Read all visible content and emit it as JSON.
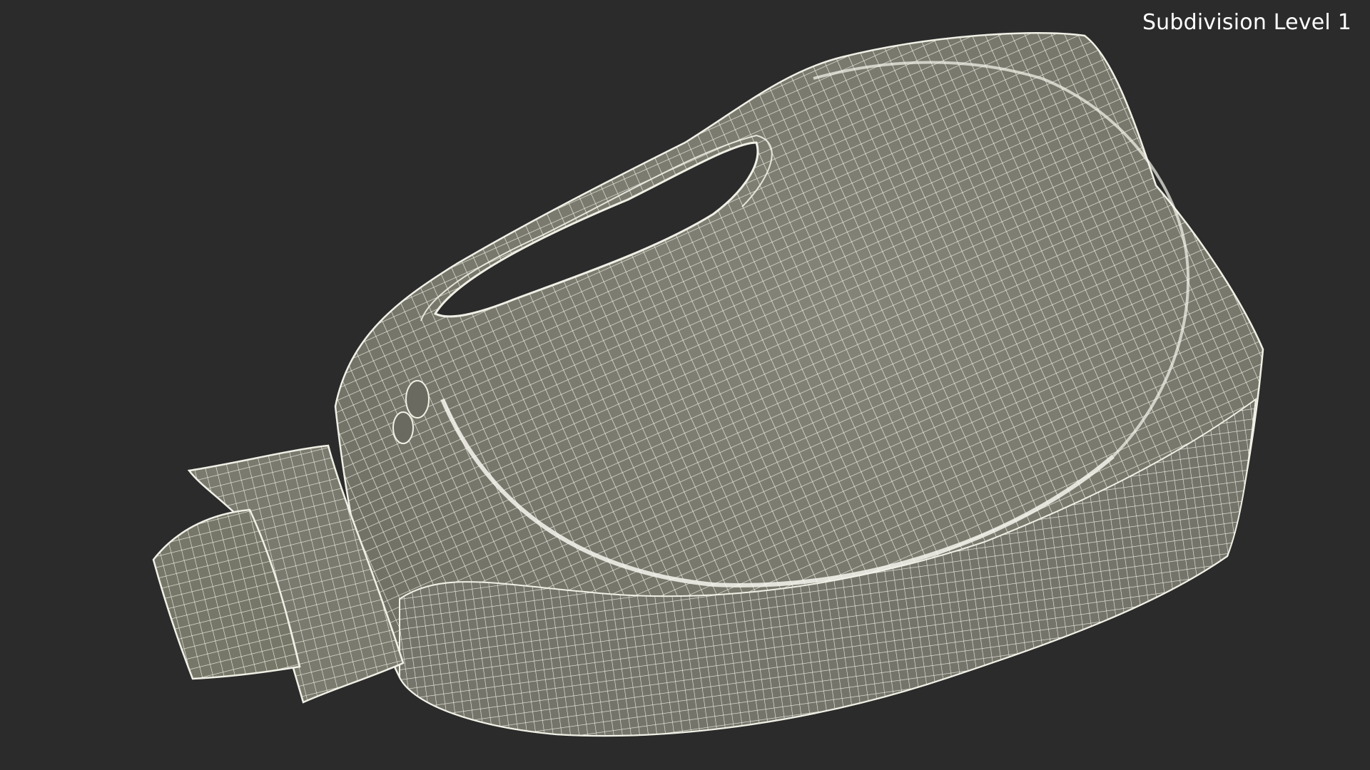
{
  "viewport": {
    "label": "Subdivision Level 1",
    "background_color": "#2b2b2b",
    "mesh_fill_color": "#7b7b6f",
    "wire_color": "#f1f0e6"
  },
  "model": {
    "render_mode": "wireframe-on-shaded",
    "icon": "mesh-model-icon"
  }
}
